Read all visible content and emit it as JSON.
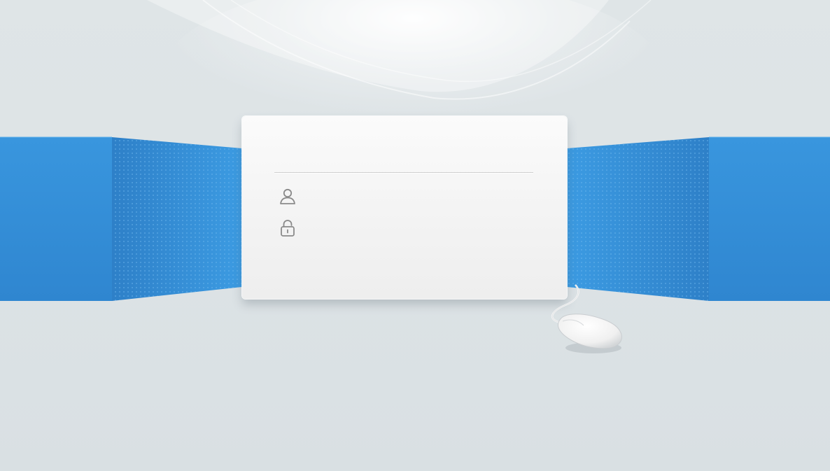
{
  "login": {
    "title": "",
    "username": {
      "icon": "user-icon",
      "value": "",
      "placeholder": ""
    },
    "password": {
      "icon": "lock-icon",
      "value": "",
      "placeholder": ""
    }
  },
  "colors": {
    "background": "#dde3e6",
    "band_blue": "#3a97e0",
    "card": "#f4f4f4",
    "icon_gray": "#8a8a8a"
  }
}
